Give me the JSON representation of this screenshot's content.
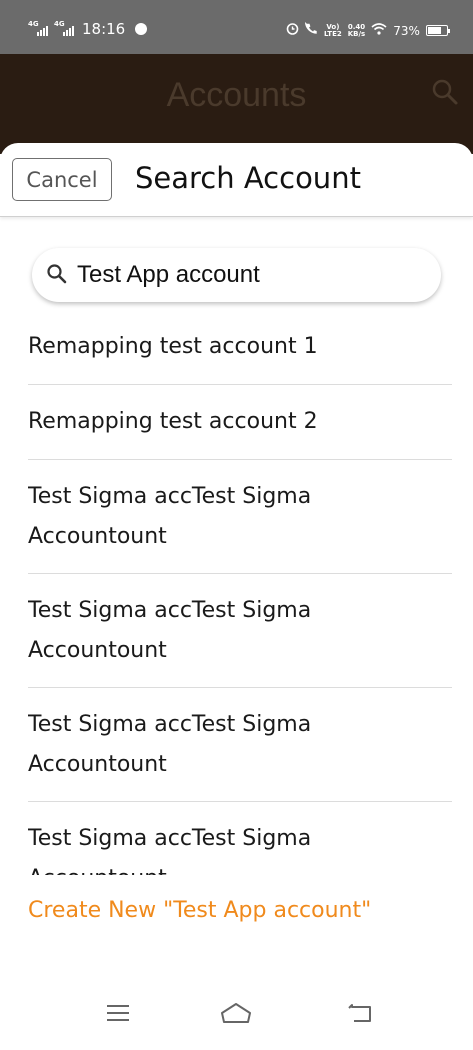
{
  "status_bar": {
    "network1": "4G",
    "network2": "4G",
    "time": "18:16",
    "volte": "Vo)",
    "lte": "LTE2",
    "speed_value": "0.40",
    "speed_unit": "KB/s",
    "battery_percent": "73%",
    "battery_level": 0.73
  },
  "background": {
    "title": "Accounts"
  },
  "sheet": {
    "cancel_label": "Cancel",
    "title": "Search Account",
    "search": {
      "value": "Test App account"
    },
    "results": [
      "Remapping test account 1",
      "Remapping test account 2",
      "Test Sigma accTest Sigma Accountount",
      "Test Sigma accTest Sigma Accountount",
      "Test Sigma accTest Sigma Accountount",
      "Test Sigma accTest Sigma Accountount"
    ],
    "create_new_label": "Create New \"Test App account\""
  },
  "colors": {
    "accent": "#f08a1c",
    "status_bar": "#6b6b6b",
    "dim_header": "#2a1c12"
  },
  "icons": {
    "search": "search-icon",
    "menu": "menu-icon",
    "home": "home-icon",
    "back": "back-icon"
  }
}
